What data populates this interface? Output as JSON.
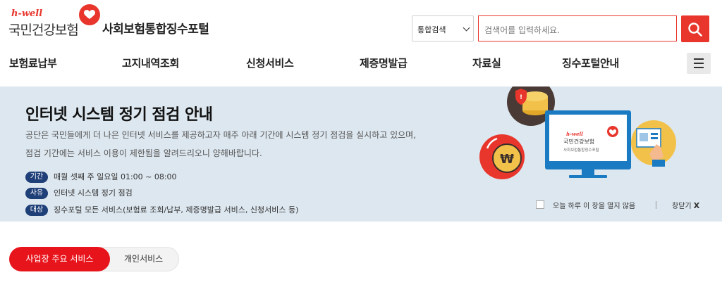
{
  "header": {
    "logo_tagline": "h-well",
    "logo_name": "국민건강보험",
    "portal_title": "사회보험통합징수포털",
    "search": {
      "select_value": "통합검색",
      "placeholder": "검색어를 입력하세요."
    }
  },
  "nav": {
    "items": [
      "보험료납부",
      "고지내역조회",
      "신청서비스",
      "제증명발급",
      "자료실",
      "징수포털안내"
    ]
  },
  "banner": {
    "title": "인터넷 시스템 정기 점검 안내",
    "description_line1": "공단은 국민들에게 더 나은 인터넷 서비스를 제공하고자 매주 아래 기간에 시스템 정기 점검을 실시하고 있으며,",
    "description_line2": "점검 기간에는 서비스 이용이 제한됨을 알려드리오니 양해바랍니다.",
    "info": [
      {
        "label": "기간",
        "text": "매월 셋째 주 일요일 01:00 ~ 08:00"
      },
      {
        "label": "사유",
        "text": "인터넷 시스템 정기 점검"
      },
      {
        "label": "대상",
        "text": "징수포털 모든 서비스(보험료 조회/납부, 제증명발급 서비스, 신청서비스 등)"
      }
    ],
    "illustration": {
      "monitor_tagline": "h-well",
      "monitor_name": "국민건강보험",
      "monitor_sub": "사회보험통합징수포털",
      "coin_symbol": "₩"
    },
    "dont_show_label": "오늘 하루 이 창을 열지 않음",
    "close_label": "창닫기",
    "close_x": "X"
  },
  "tabs": {
    "business": "사업장 주요 서비스",
    "personal": "개인서비스"
  },
  "colors": {
    "brand_red": "#e8362d",
    "badge_navy": "#1f3f78",
    "banner_bg": "#dde7ef"
  }
}
